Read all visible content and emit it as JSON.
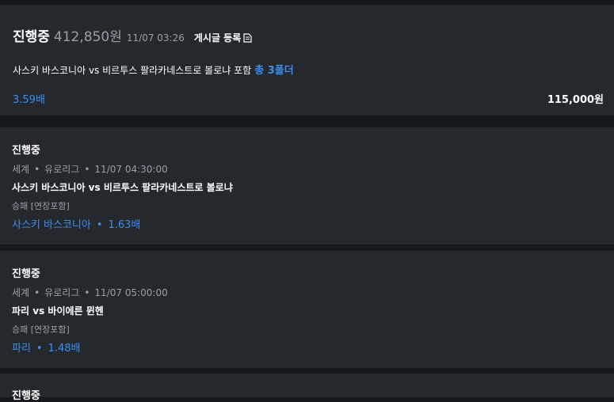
{
  "summary": {
    "status": "진행중",
    "amount": "412,850원",
    "datetime": "11/07 03:26",
    "post_label": "게시글 등록",
    "description": "사스키 바스코니아 vs 비르투스 팔라카네스트로 볼로냐 포함",
    "folder_label": "총 3폴더",
    "odds": "3.59배",
    "stake": "115,000원"
  },
  "matches": [
    {
      "status": "진행중",
      "region": "세계",
      "league": "유로리그",
      "time": "11/07 04:30:00",
      "teams": "사스키 바스코니아 vs 비르투스 팔라카네스트로 볼로냐",
      "market": "승패 [연장포함]",
      "pick": "사스키 바스코니아",
      "odds": "1.63배"
    },
    {
      "status": "진행중",
      "region": "세계",
      "league": "유로리그",
      "time": "11/07 05:00:00",
      "teams": "파리 vs 바이에른 뮌헨",
      "market": "승패 [연장포함]",
      "pick": "파리",
      "odds": "1.48배"
    },
    {
      "status": "진행중"
    }
  ],
  "separator": "•",
  "colors": {
    "accent": "#3a8ff0",
    "card": "#25282d",
    "background": "#16181b"
  },
  "icons": {
    "post": "document-edit-icon"
  }
}
